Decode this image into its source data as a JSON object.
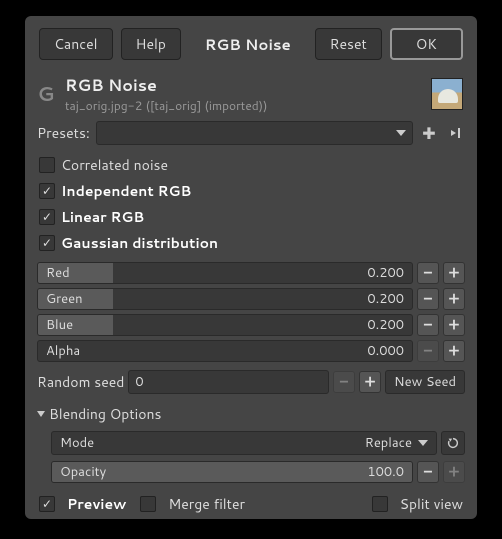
{
  "buttons": {
    "cancel": "Cancel",
    "help": "Help",
    "reset": "Reset",
    "ok": "OK"
  },
  "window_title": "RGB Noise",
  "header": {
    "title": "RGB Noise",
    "subtitle": "taj_orig.jpg-2 ([taj_orig] (imported))"
  },
  "presets_label": "Presets:",
  "checks": {
    "correlated": "Correlated noise",
    "independent": "Independent RGB",
    "linear": "Linear RGB",
    "gaussian": "Gaussian distribution"
  },
  "channels": {
    "red": {
      "label": "Red",
      "value": "0.200",
      "fill_pct": 20
    },
    "green": {
      "label": "Green",
      "value": "0.200",
      "fill_pct": 20
    },
    "blue": {
      "label": "Blue",
      "value": "0.200",
      "fill_pct": 20
    },
    "alpha": {
      "label": "Alpha",
      "value": "0.000",
      "fill_pct": 0
    }
  },
  "seed": {
    "label": "Random seed",
    "value": "0",
    "new_seed": "New Seed"
  },
  "blending": {
    "title": "Blending Options",
    "mode_label": "Mode",
    "mode_value": "Replace",
    "opacity_label": "Opacity",
    "opacity_value": "100.0"
  },
  "footer": {
    "preview": "Preview",
    "merge": "Merge filter",
    "split": "Split view"
  }
}
